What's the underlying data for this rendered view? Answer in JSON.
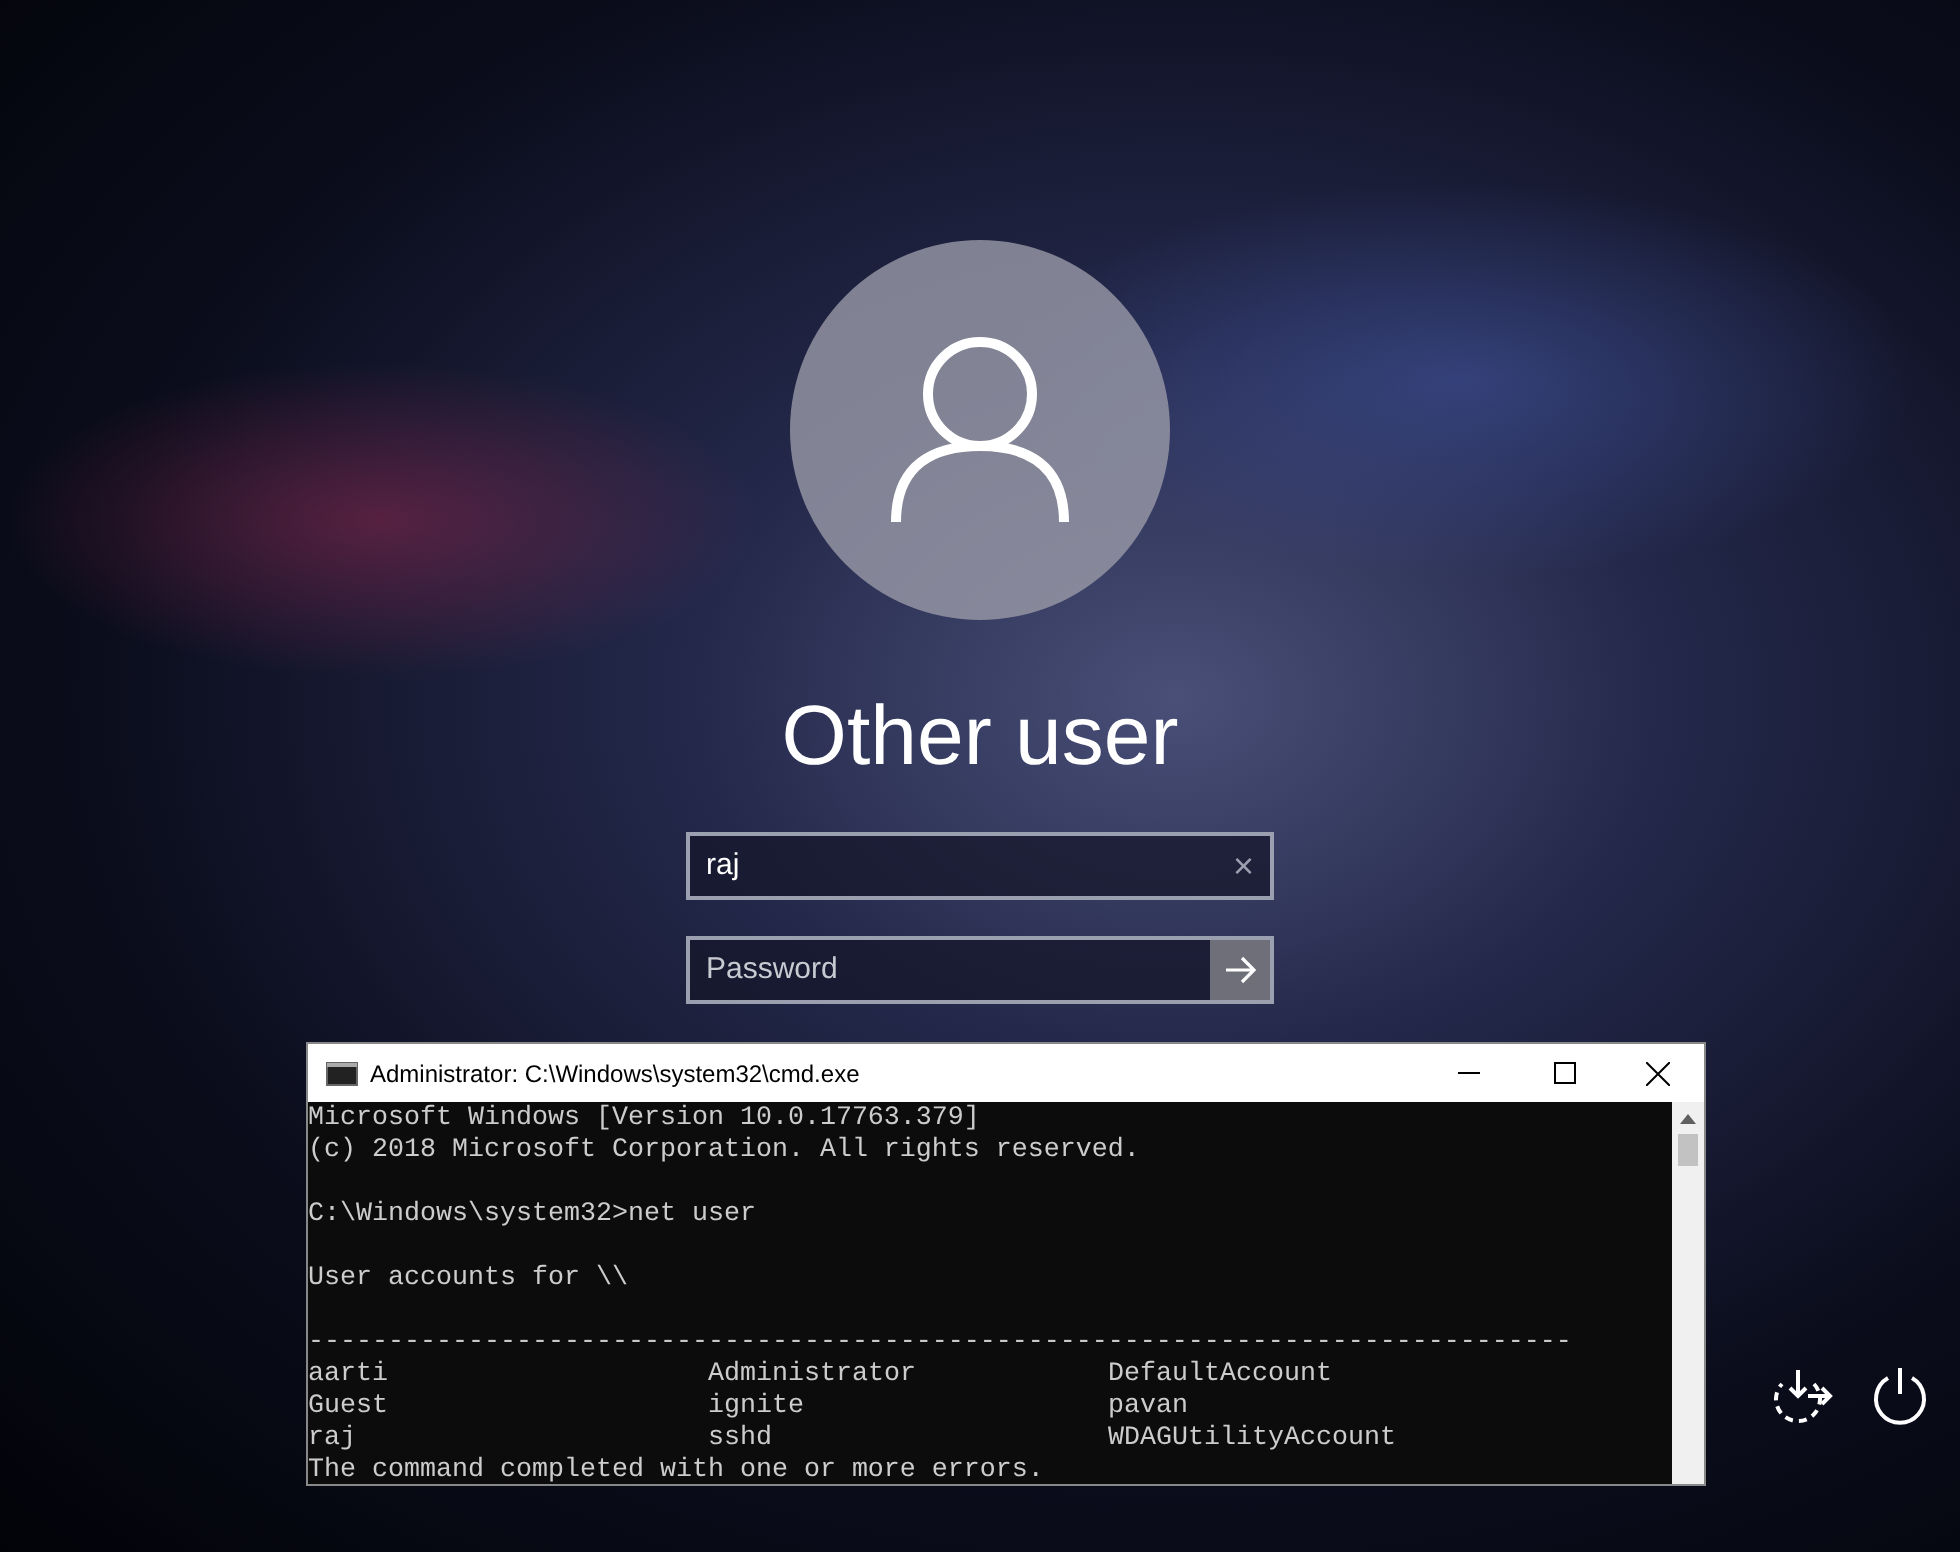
{
  "user": {
    "name": "Other user"
  },
  "username_field": {
    "value": "raj",
    "clear_glyph": "×"
  },
  "password_field": {
    "placeholder": "Password"
  },
  "console": {
    "title": "Administrator: C:\\Windows\\system32\\cmd.exe",
    "lines": [
      {
        "kind": "text",
        "text": "Microsoft Windows [Version 10.0.17763.379]"
      },
      {
        "kind": "text",
        "text": "(c) 2018 Microsoft Corporation. All rights reserved."
      },
      {
        "kind": "blank"
      },
      {
        "kind": "text",
        "text": "C:\\Windows\\system32>net user"
      },
      {
        "kind": "blank"
      },
      {
        "kind": "text",
        "text": "User accounts for \\\\"
      },
      {
        "kind": "blank"
      },
      {
        "kind": "text",
        "text": "-------------------------------------------------------------------------------"
      },
      {
        "kind": "columns",
        "cells": [
          "aarti",
          "Administrator",
          "DefaultAccount"
        ]
      },
      {
        "kind": "columns",
        "cells": [
          "Guest",
          "ignite",
          "pavan"
        ]
      },
      {
        "kind": "columns",
        "cells": [
          "raj",
          "sshd",
          "WDAGUtilityAccount"
        ]
      },
      {
        "kind": "text",
        "text": "The command completed with one or more errors."
      }
    ]
  }
}
